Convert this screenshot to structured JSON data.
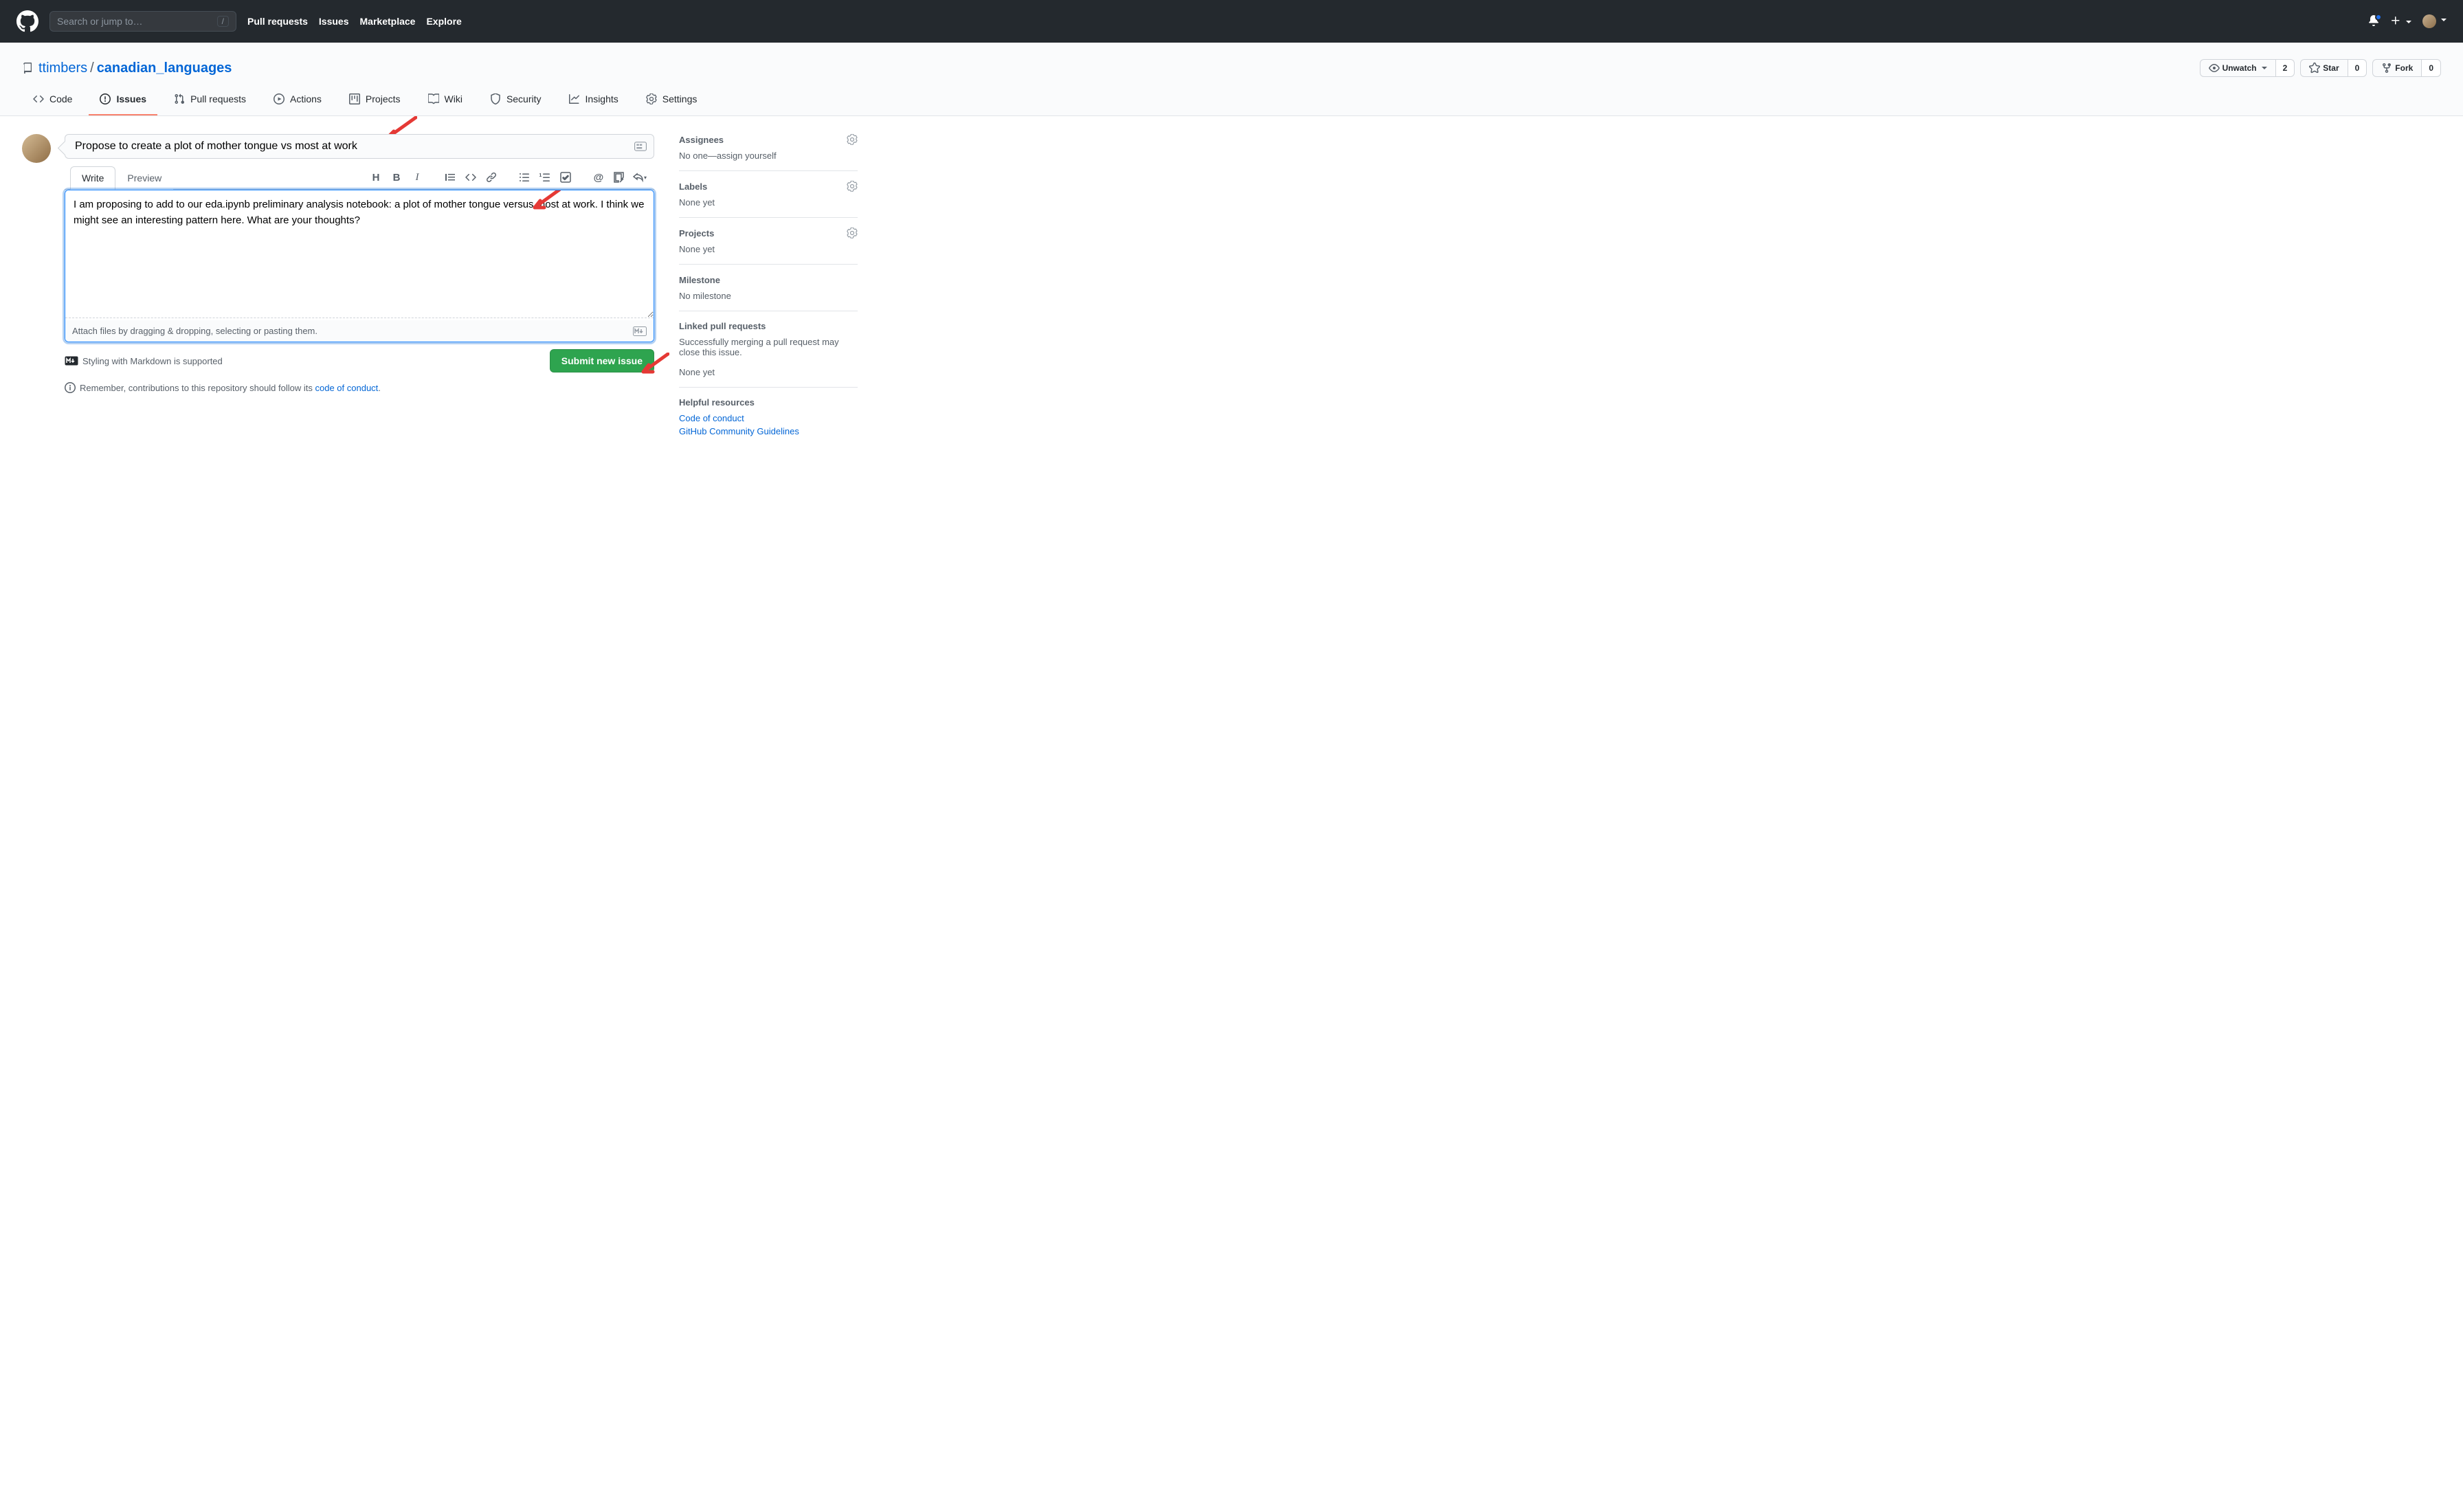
{
  "header": {
    "search_placeholder": "Search or jump to…",
    "search_key": "/",
    "nav": {
      "pull_requests": "Pull requests",
      "issues": "Issues",
      "marketplace": "Marketplace",
      "explore": "Explore"
    }
  },
  "repo": {
    "owner": "ttimbers",
    "separator": "/",
    "name": "canadian_languages",
    "watch_label": "Unwatch",
    "watch_count": "2",
    "star_label": "Star",
    "star_count": "0",
    "fork_label": "Fork",
    "fork_count": "0",
    "nav": {
      "code": "Code",
      "issues": "Issues",
      "pull_requests": "Pull requests",
      "actions": "Actions",
      "projects": "Projects",
      "wiki": "Wiki",
      "security": "Security",
      "insights": "Insights",
      "settings": "Settings"
    }
  },
  "issue": {
    "title": "Propose to create a plot of mother tongue vs most at work",
    "tabs": {
      "write": "Write",
      "preview": "Preview"
    },
    "body": "I am proposing to add to our eda.ipynb preliminary analysis notebook: a plot of mother tongue versus most at work. I think we might see an interesting pattern here. What are your thoughts?",
    "attach_hint": "Attach files by dragging & dropping, selecting or pasting them.",
    "markdown_hint": "Styling with Markdown is supported",
    "submit_label": "Submit new issue",
    "contrib_prefix": "Remember, contributions to this repository should follow its ",
    "contrib_link": "code of conduct",
    "contrib_suffix": "."
  },
  "sidebar": {
    "assignees": {
      "title": "Assignees",
      "body": "No one—assign yourself"
    },
    "labels": {
      "title": "Labels",
      "body": "None yet"
    },
    "projects": {
      "title": "Projects",
      "body": "None yet"
    },
    "milestone": {
      "title": "Milestone",
      "body": "No milestone"
    },
    "linked_prs": {
      "title": "Linked pull requests",
      "desc": "Successfully merging a pull request may close this issue.",
      "body": "None yet"
    },
    "resources": {
      "title": "Helpful resources",
      "link1": "Code of conduct",
      "link2": "GitHub Community Guidelines"
    }
  }
}
